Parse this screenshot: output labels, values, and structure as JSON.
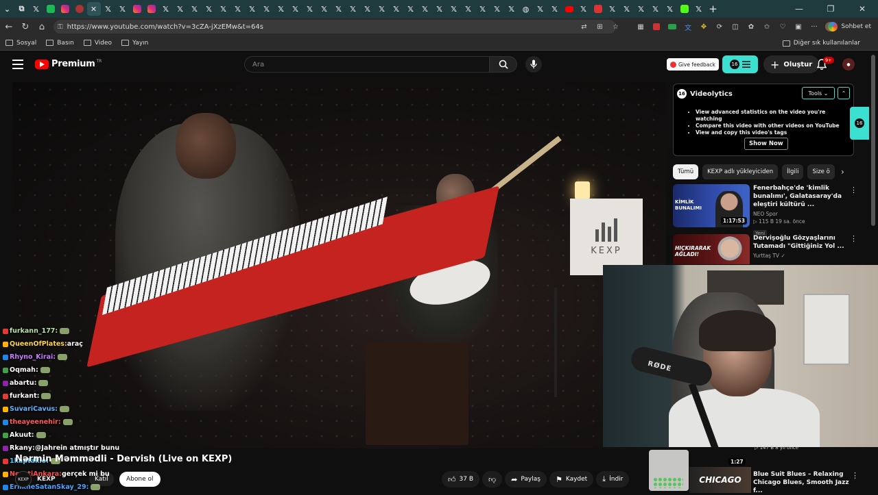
{
  "browser": {
    "url": "https://www.youtube.com/watch?v=3cZA-jXzEMw&t=64s",
    "bookmarks": [
      "Sosyal",
      "Basın",
      "Video",
      "Yayın"
    ],
    "other_bookmarks": "Diğer sık kullanılanlar",
    "chat_button": "Sohbet et"
  },
  "youtube": {
    "logo_text": "Premium",
    "logo_region": "TR",
    "search_placeholder": "Ara",
    "give_feedback": "Give feedback",
    "create_label": "Oluştur",
    "notification_count": "9+",
    "video": {
      "title": "Nərmin Məmmədli - Dervish (Live on KEXP)",
      "channel": "KEXP",
      "join_label": "Katıl",
      "subscribe_label": "Abone ol",
      "like_count": "37 B",
      "share_label": "Paylaş",
      "save_label": "Kaydet",
      "download_label": "İndir",
      "sign_text": "KEXP"
    },
    "videolytics": {
      "name": "Videolytics",
      "tools_label": "Tools",
      "features": [
        "View advanced statistics on the video you're watching",
        "Compare this video with other videos on YouTube",
        "View and copy this video's tags"
      ],
      "show_now": "Show Now"
    },
    "chips": [
      "Tümü",
      "KEXP adlı yükleyiciden",
      "İlgili",
      "Size ö"
    ],
    "recommendations": [
      {
        "title": "Fenerbahçe'de 'kimlik bunalımı', Galatasaray'da eleştiri kültürü ...",
        "channel": "NEO Spor",
        "meta": "▷ 115 B  19 sa. önce",
        "badge": "Yeni",
        "duration": "1:17:53",
        "thumb_text": "KİMLİK BUNALIMI"
      },
      {
        "title": "Dervişoğlu Gözyaşlarını Tutamadı \"Gittiğiniz Yol ...",
        "channel": "Yurttaş TV",
        "meta": "",
        "badge": "",
        "duration": "",
        "thumb_text": "HIÇKIRARAK AĞLADI!"
      }
    ],
    "bottom_rec": {
      "title": "Blue Suit Blues – Relaxing Chicago Blues, Smooth Jazz f...",
      "thumb_text": "CHICAGO",
      "duration": "1:27",
      "meta": "▷ 147 B  8 yıl önce"
    }
  },
  "chat": [
    {
      "user": "furkann_177:",
      "msg": "",
      "color": "#b6e3a8"
    },
    {
      "user": "QueenOfPlates:",
      "msg": " araç",
      "color": "#ffd54a"
    },
    {
      "user": "Rhyno_Kirai:",
      "msg": "",
      "color": "#c77dff"
    },
    {
      "user": "Oqmah:",
      "msg": "",
      "color": "#ffffff"
    },
    {
      "user": "abartu:",
      "msg": "",
      "color": "#ffffff"
    },
    {
      "user": "furkant:",
      "msg": "",
      "color": "#ffffff"
    },
    {
      "user": "SuvariCavus:",
      "msg": "",
      "color": "#5fb3ff"
    },
    {
      "user": "theayeenehir:",
      "msg": "",
      "color": "#ff5a5a"
    },
    {
      "user": "Akuut:",
      "msg": "",
      "color": "#ffffff"
    },
    {
      "user": "Rkany:",
      "msg": " @Jahrein atmıştır bunu",
      "color": "#ffffff"
    },
    {
      "user": "1kaptaklo:",
      "msg": "",
      "color": "#4fc3f7"
    },
    {
      "user": "NecatiAnkara:",
      "msg": " gerçek mi bu",
      "color": "#ff4d4d"
    },
    {
      "user": "ErlikheSatanSkay_29:",
      "msg": "",
      "color": "#4fa3ff"
    }
  ],
  "webcam": {
    "mic_brand": "RØDE"
  },
  "colors": {
    "accent": "#3ce0d0",
    "youtube_red": "#ff0000",
    "tab_bar": "#1f3b3d"
  }
}
